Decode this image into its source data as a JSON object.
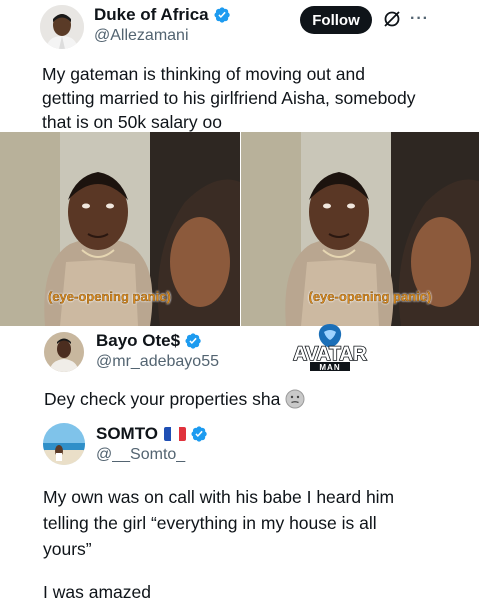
{
  "tweet1": {
    "display_name": "Duke of Africa",
    "handle": "@Allezamani",
    "follow_label": "Follow",
    "more_label": "···",
    "text_lines": [
      "My gateman is thinking of moving out and",
      "getting married to his girlfriend Aisha, somebody",
      "that is on 50k salary oo"
    ]
  },
  "media": {
    "caption_left": "(eye-opening panic)",
    "caption_right": "(eye-opening panic)"
  },
  "watermark": {
    "word": "AVATAR",
    "sub": "MAN"
  },
  "reply1": {
    "display_name": "Bayo Ote$",
    "handle": "@mr_adebayo55",
    "text": "Dey check your properties sha"
  },
  "reply2": {
    "display_name": "SOMTO",
    "handle": "@__Somto_",
    "text_lines": [
      "My own was on call with his babe I heard him",
      "telling the girl “everything in my house is all",
      "yours”"
    ],
    "text_after": "I was amazed"
  },
  "colors": {
    "verified_blue": "#1d9bf0",
    "text_primary": "#0f1419",
    "text_secondary": "#536471",
    "caption_orange": "#d98a1e"
  },
  "icons": [
    "verified-badge-icon",
    "grok-icon",
    "more-options-icon",
    "thinking-face-emoji",
    "france-flag-emoji"
  ]
}
